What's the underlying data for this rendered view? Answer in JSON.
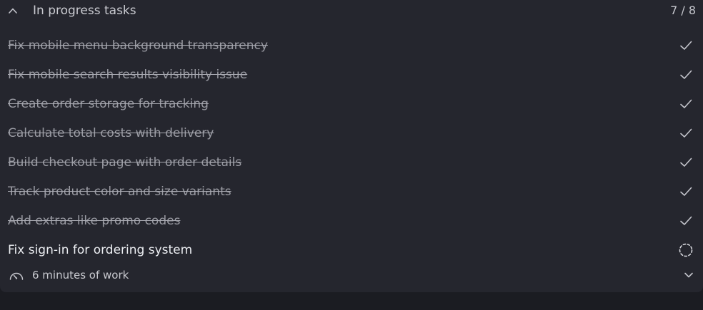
{
  "header": {
    "title": "In progress tasks",
    "counter": "7 / 8",
    "collapse_icon": "chevron-up-icon"
  },
  "tasks": [
    {
      "label": "Fix mobile menu background transparency",
      "status": "done"
    },
    {
      "label": "Fix mobile search results visibility issue",
      "status": "done"
    },
    {
      "label": "Create order storage for tracking",
      "status": "done"
    },
    {
      "label": "Calculate total costs with delivery",
      "status": "done"
    },
    {
      "label": "Build checkout page with order details",
      "status": "done"
    },
    {
      "label": "Track product color and size variants",
      "status": "done"
    },
    {
      "label": "Add extras like promo codes",
      "status": "done"
    },
    {
      "label": "Fix sign-in for ordering system",
      "status": "in-progress"
    }
  ],
  "footer": {
    "duration": "6 minutes of work",
    "icon": "gauge-icon",
    "expand_icon": "chevron-down-icon"
  },
  "colors": {
    "background": "#1b1c22",
    "panel": "#25262e",
    "done_text": "#9a9ba3",
    "active_text": "#eceef2",
    "icon": "#c4c5cc"
  }
}
